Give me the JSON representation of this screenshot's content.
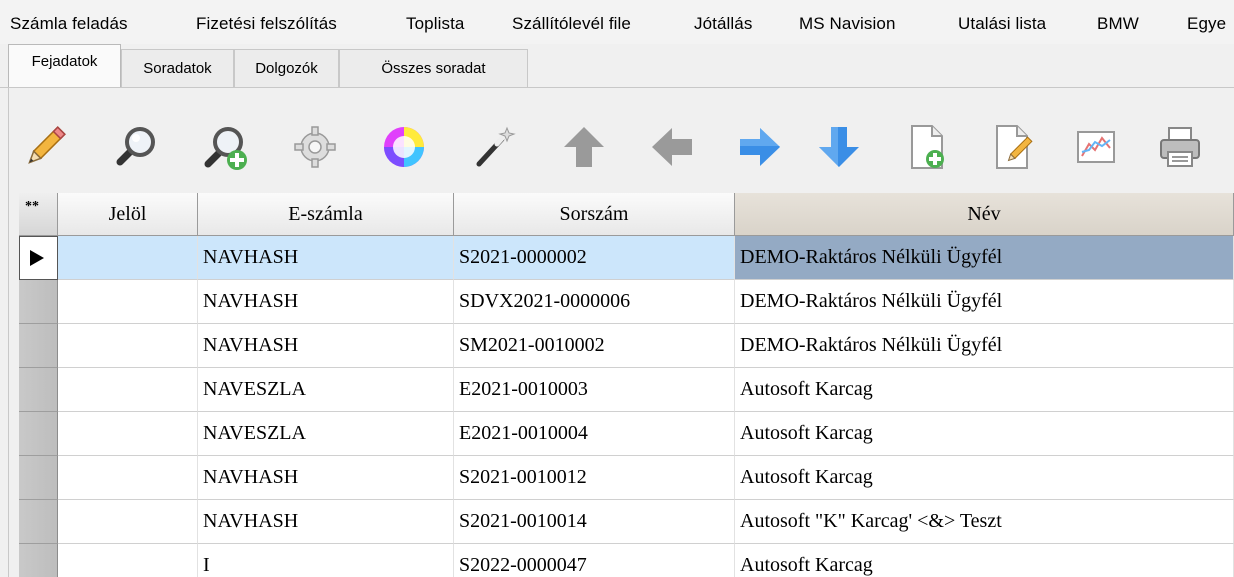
{
  "menu": {
    "items": [
      "Számla feladás",
      "Fizetési felszólítás",
      "Toplista",
      "Szállítólevél file",
      "Jótállás",
      "MS Navision",
      "Utalási lista",
      "BMW",
      "Egye"
    ]
  },
  "tabs": {
    "items": [
      "Fejadatok",
      "Soradatok",
      "Dolgozók",
      "Összes soradat"
    ],
    "active": "Fejadatok"
  },
  "toolbar": {
    "icons": [
      "pencil-icon",
      "magnifier-icon",
      "magnifier-add-icon",
      "gear-icon",
      "color-wheel-icon",
      "magic-wand-icon",
      "arrow-up-icon",
      "arrow-left-icon",
      "arrow-right-icon",
      "arrow-down-icon",
      "new-document-icon",
      "edit-document-icon",
      "chart-icon",
      "printer-icon"
    ]
  },
  "grid": {
    "corner_label": "**",
    "columns": [
      "Jelöl",
      "E-számla",
      "Sorszám",
      "Név"
    ],
    "sorted_column": "Név",
    "rows": [
      {
        "jelol": "",
        "eszamla": "NAVHASH",
        "sorszam": "S2021-0000002",
        "nev": "DEMO-Raktáros Nélküli Ügyfél",
        "current": true
      },
      {
        "jelol": "",
        "eszamla": "NAVHASH",
        "sorszam": "SDVX2021-0000006",
        "nev": "DEMO-Raktáros Nélküli Ügyfél"
      },
      {
        "jelol": "",
        "eszamla": "NAVHASH",
        "sorszam": "SM2021-0010002",
        "nev": "DEMO-Raktáros Nélküli Ügyfél"
      },
      {
        "jelol": "",
        "eszamla": "NAVESZLA",
        "sorszam": "E2021-0010003",
        "nev": "Autosoft Karcag"
      },
      {
        "jelol": "",
        "eszamla": "NAVESZLA",
        "sorszam": "E2021-0010004",
        "nev": "Autosoft Karcag"
      },
      {
        "jelol": "",
        "eszamla": "NAVHASH",
        "sorszam": "S2021-0010012",
        "nev": "Autosoft Karcag"
      },
      {
        "jelol": "",
        "eszamla": "NAVHASH",
        "sorszam": "S2021-0010014",
        "nev": "Autosoft \"K\" Karcag' <&> Teszt"
      },
      {
        "jelol": "",
        "eszamla": "I",
        "sorszam": "S2022-0000047",
        "nev": "Autosoft Karcag"
      }
    ]
  },
  "colors": {
    "selected_row": "#cce6fb",
    "selected_cell": "#94aac4",
    "arrow_blue": "#3a8ee6",
    "arrow_gray": "#9a9a9a"
  }
}
